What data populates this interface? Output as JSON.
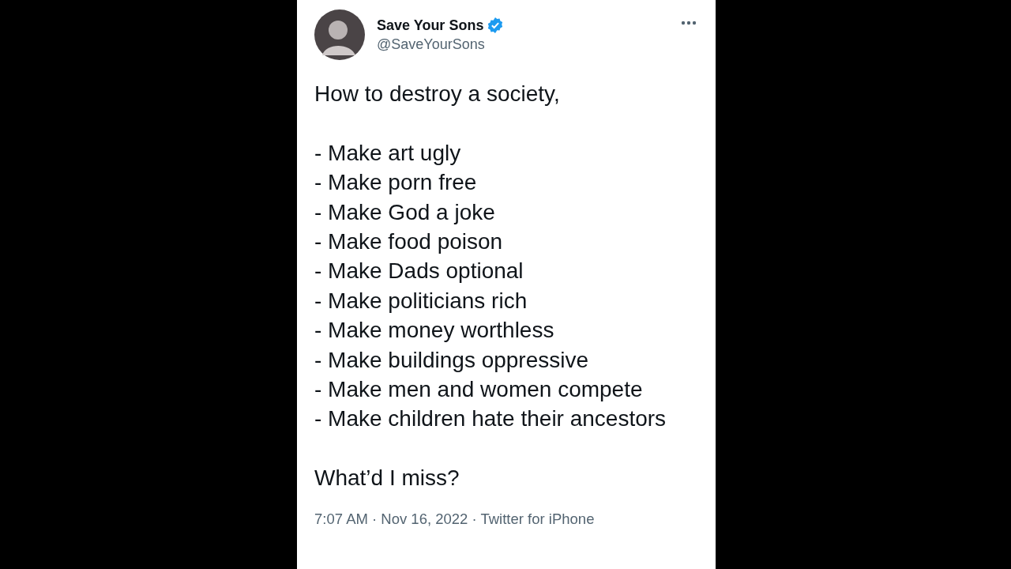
{
  "tweet": {
    "author": {
      "name": "Save Your Sons",
      "handle": "@SaveYourSons",
      "verified": true
    },
    "intro": "How to destroy a society,",
    "items": [
      "- Make art ugly",
      "- Make porn free",
      "- Make God a joke",
      "- Make food poison",
      "- Make Dads optional",
      "- Make politicians rich",
      "- Make money worthless",
      "- Make buildings oppressive",
      "- Make men and women compete",
      "- Make children hate their ancestors"
    ],
    "closing": "What’d I miss?",
    "meta": "7:07 AM · Nov 16, 2022 · Twitter for iPhone"
  }
}
